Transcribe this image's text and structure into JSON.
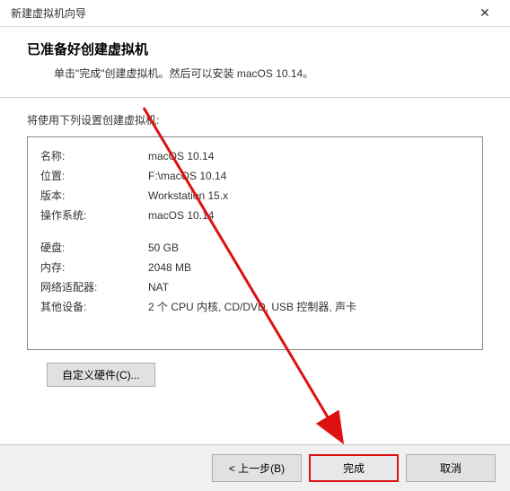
{
  "titlebar": {
    "title": "新建虚拟机向导"
  },
  "header": {
    "title": "已准备好创建虚拟机",
    "subtitle": "单击\"完成\"创建虚拟机。然后可以安装 macOS 10.14。"
  },
  "settings_intro": "将使用下列设置创建虚拟机:",
  "settings": {
    "name_label": "名称:",
    "name_value": "macOS 10.14",
    "location_label": "位置:",
    "location_value": "F:\\macOS 10.14",
    "version_label": "版本:",
    "version_value": "Workstation 15.x",
    "os_label": "操作系统:",
    "os_value": "macOS 10.14",
    "disk_label": "硬盘:",
    "disk_value": "50 GB",
    "memory_label": "内存:",
    "memory_value": "2048 MB",
    "network_label": "网络适配器:",
    "network_value": "NAT",
    "other_label": "其他设备:",
    "other_value": "2 个 CPU 内核, CD/DVD, USB 控制器, 声卡"
  },
  "buttons": {
    "customize": "自定义硬件(C)...",
    "back": "< 上一步(B)",
    "finish": "完成",
    "cancel": "取消"
  }
}
